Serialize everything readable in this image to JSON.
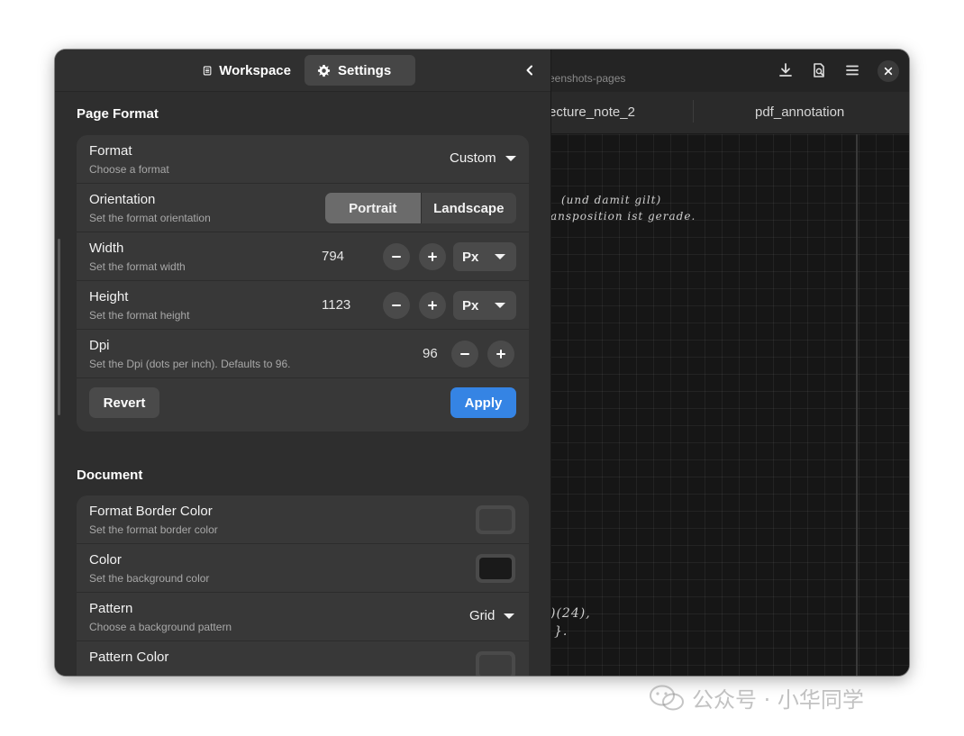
{
  "sidebar": {
    "tabs": [
      {
        "label": "Workspace",
        "icon": "document-icon"
      },
      {
        "label": "Settings",
        "icon": "gear-icon"
      }
    ],
    "page_format": {
      "title": "Page Format",
      "format": {
        "title": "Format",
        "subtitle": "Choose a format",
        "value": "Custom"
      },
      "orientation": {
        "title": "Orientation",
        "subtitle": "Set the format orientation",
        "options": [
          "Portrait",
          "Landscape"
        ],
        "selected": "Portrait"
      },
      "width": {
        "title": "Width",
        "subtitle": "Set the format width",
        "value": "794",
        "unit": "Px"
      },
      "height": {
        "title": "Height",
        "subtitle": "Set the format height",
        "value": "1123",
        "unit": "Px"
      },
      "dpi": {
        "title": "Dpi",
        "subtitle": "Set the Dpi (dots per inch). Defaults to 96.",
        "value": "96"
      },
      "revert_label": "Revert",
      "apply_label": "Apply"
    },
    "document": {
      "title": "Document",
      "border_color": {
        "title": "Format Border Color",
        "subtitle": "Set the format border color",
        "color": "#3d3d3d"
      },
      "color": {
        "title": "Color",
        "subtitle": "Set the background color",
        "color": "#1a1a1a"
      },
      "pattern": {
        "title": "Pattern",
        "subtitle": "Choose a background pattern",
        "value": "Grid"
      },
      "pattern_color": {
        "title": "Pattern Color",
        "color": "#3d3d3d"
      }
    }
  },
  "doc": {
    "path": "eenshots-pages",
    "tabs": [
      "ecture_note_2",
      "pdf_annotation"
    ],
    "handwriting": [
      "(und damit gilt)",
      "ansposition ist gerade.",
      ")(24),",
      "}."
    ]
  },
  "watermark": {
    "text": "公众号 · 小华同学"
  },
  "colors": {
    "accent": "#3584e4",
    "sidebar_bg": "#2e2e2e",
    "row_bg": "#383838"
  }
}
